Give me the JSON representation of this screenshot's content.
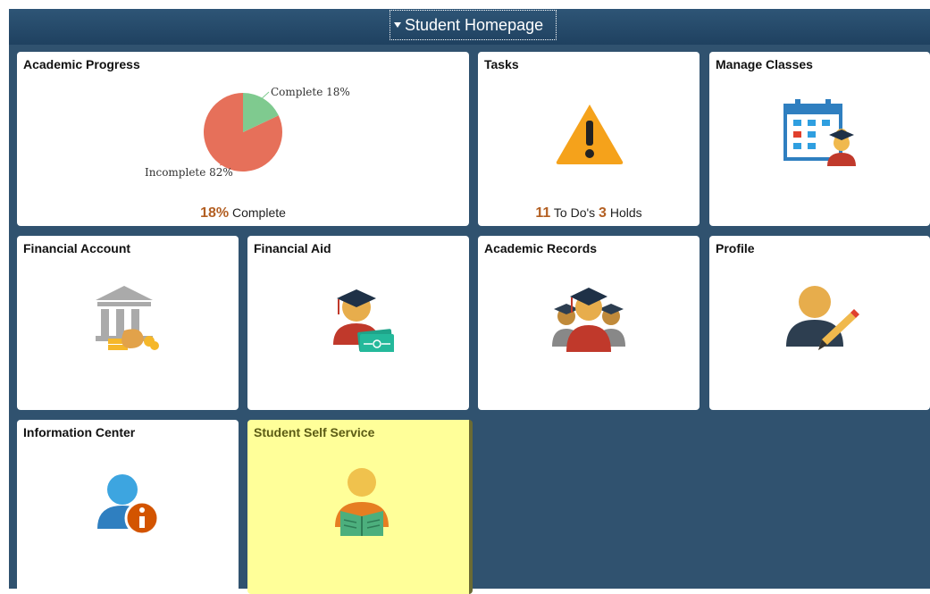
{
  "header": {
    "title": "Student Homepage"
  },
  "tiles": {
    "academic_progress": {
      "title": "Academic Progress",
      "pie": {
        "complete_pct": 18,
        "incomplete_pct": 82,
        "complete_color": "#7fca8f",
        "incomplete_color": "#e6705a"
      },
      "label_complete": "Complete 18%",
      "label_incomplete": "Incomplete 82%",
      "summary_value": "18%",
      "summary_text": "Complete"
    },
    "tasks": {
      "title": "Tasks",
      "icon": "warning-icon",
      "todos_value": "11",
      "todos_label": "To Do's",
      "holds_value": "3",
      "holds_label": "Holds"
    },
    "manage_classes": {
      "title": "Manage Classes",
      "icon": "calendar-student-icon"
    },
    "financial_account": {
      "title": "Financial Account",
      "icon": "bank-moneybag-icon"
    },
    "financial_aid": {
      "title": "Financial Aid",
      "icon": "graduate-money-icon"
    },
    "academic_records": {
      "title": "Academic Records",
      "icon": "graduates-group-icon"
    },
    "profile": {
      "title": "Profile",
      "icon": "profile-edit-icon"
    },
    "information_center": {
      "title": "Information Center",
      "icon": "person-info-icon"
    },
    "student_self_service": {
      "title": "Student Self Service",
      "icon": "student-reading-icon"
    }
  },
  "colors": {
    "background": "#30526f",
    "accent_number": "#b35f22",
    "highlight_tile": "#ffff99"
  }
}
